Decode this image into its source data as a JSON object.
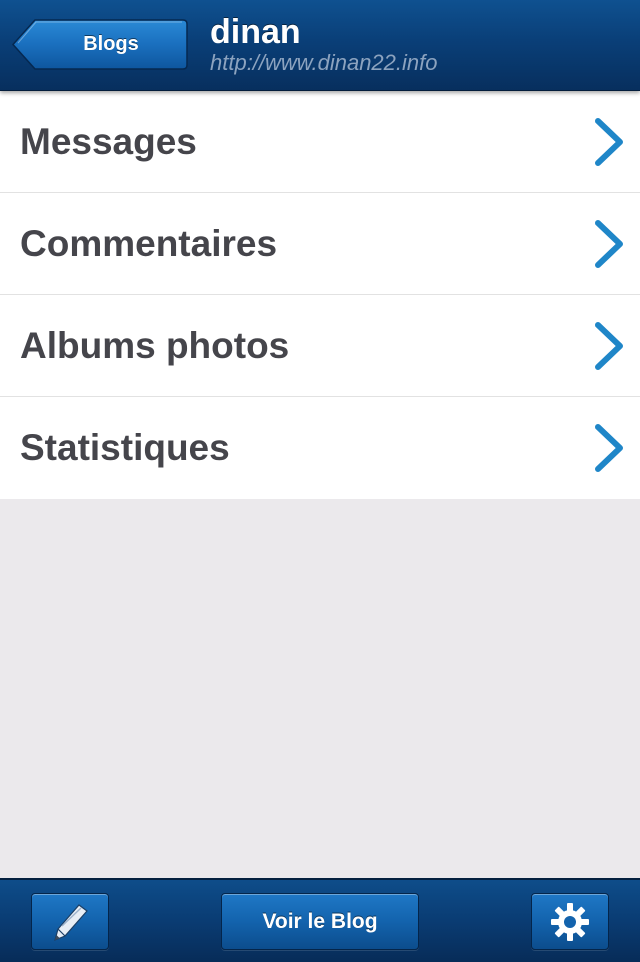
{
  "navbar": {
    "back_label": "Blogs",
    "title": "dinan",
    "url": "http://www.dinan22.info"
  },
  "menu": {
    "items": [
      {
        "label": "Messages"
      },
      {
        "label": "Commentaires"
      },
      {
        "label": "Albums photos"
      },
      {
        "label": "Statistiques"
      }
    ]
  },
  "toolbar": {
    "compose_icon": "pencil-icon",
    "view_blog_label": "Voir le Blog",
    "settings_icon": "gear-icon"
  },
  "colors": {
    "nav_bar": "#0a3f78",
    "accent": "#1f86c8",
    "menu_text": "#45454b",
    "background": "#ebe9ec"
  }
}
